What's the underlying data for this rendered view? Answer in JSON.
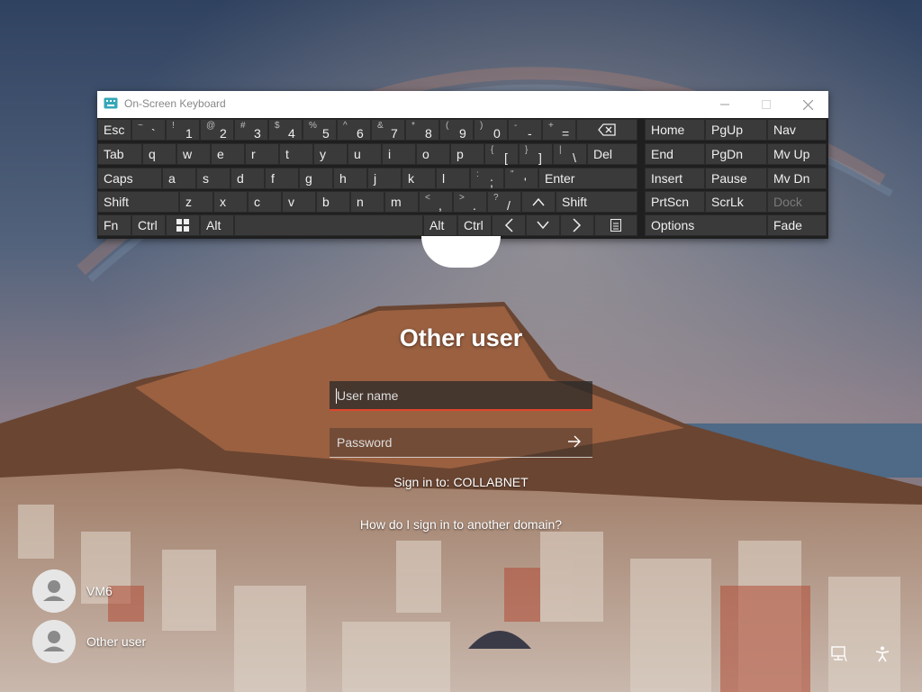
{
  "osk": {
    "title": "On-Screen Keyboard",
    "colors": {
      "titlebar": "#ffffff",
      "body": "#1f1f1f",
      "key": "#3a3a3a"
    },
    "rows": [
      [
        {
          "main": "Esc"
        },
        {
          "sec": "~",
          "pri": "`"
        },
        {
          "sec": "!",
          "pri": "1"
        },
        {
          "sec": "@",
          "pri": "2"
        },
        {
          "sec": "#",
          "pri": "3"
        },
        {
          "sec": "$",
          "pri": "4"
        },
        {
          "sec": "%",
          "pri": "5"
        },
        {
          "sec": "^",
          "pri": "6"
        },
        {
          "sec": "&",
          "pri": "7"
        },
        {
          "sec": "*",
          "pri": "8"
        },
        {
          "sec": "(",
          "pri": "9"
        },
        {
          "sec": ")",
          "pri": "0"
        },
        {
          "sec": "-",
          "pri": "-"
        },
        {
          "sec": "+",
          "pri": "="
        },
        {
          "icon": "backspace-icon"
        }
      ],
      [
        {
          "main": "Tab"
        },
        {
          "main": "q"
        },
        {
          "main": "w"
        },
        {
          "main": "e"
        },
        {
          "main": "r"
        },
        {
          "main": "t"
        },
        {
          "main": "y"
        },
        {
          "main": "u"
        },
        {
          "main": "i"
        },
        {
          "main": "o"
        },
        {
          "main": "p"
        },
        {
          "sec": "{",
          "pri": "["
        },
        {
          "sec": "}",
          "pri": "]"
        },
        {
          "sec": "|",
          "pri": "\\"
        },
        {
          "main": "Del"
        }
      ],
      [
        {
          "main": "Caps"
        },
        {
          "main": "a"
        },
        {
          "main": "s"
        },
        {
          "main": "d"
        },
        {
          "main": "f"
        },
        {
          "main": "g"
        },
        {
          "main": "h"
        },
        {
          "main": "j"
        },
        {
          "main": "k"
        },
        {
          "main": "l"
        },
        {
          "sec": ":",
          "pri": ";"
        },
        {
          "sec": "\"",
          "pri": "'"
        },
        {
          "main": "Enter"
        }
      ],
      [
        {
          "main": "Shift"
        },
        {
          "main": "z"
        },
        {
          "main": "x"
        },
        {
          "main": "c"
        },
        {
          "main": "v"
        },
        {
          "main": "b"
        },
        {
          "main": "n"
        },
        {
          "main": "m"
        },
        {
          "sec": "<",
          "pri": ","
        },
        {
          "sec": ">",
          "pri": "."
        },
        {
          "sec": "?",
          "pri": "/"
        },
        {
          "icon": "arrow-up-icon"
        },
        {
          "main": "Shift"
        }
      ],
      [
        {
          "main": "Fn"
        },
        {
          "main": "Ctrl"
        },
        {
          "icon": "windows-icon"
        },
        {
          "main": "Alt"
        },
        {
          "main": ""
        },
        {
          "main": "Alt"
        },
        {
          "main": "Ctrl"
        },
        {
          "icon": "arrow-left-icon"
        },
        {
          "icon": "arrow-down-icon"
        },
        {
          "icon": "arrow-right-icon"
        },
        {
          "icon": "menu-icon"
        }
      ]
    ],
    "nav_cols": [
      [
        "Home",
        "End",
        "Insert",
        "PrtScn",
        "Options"
      ],
      [
        "PgUp",
        "PgDn",
        "Pause",
        "ScrLk",
        ""
      ],
      [
        "Nav",
        "Mv Up",
        "Mv Dn",
        "Dock",
        "Fade"
      ]
    ]
  },
  "signin": {
    "title": "Other user",
    "username_placeholder": "User name",
    "password_placeholder": "Password",
    "domain_text": "Sign in to: COLLABNET",
    "domain_help": "How do I sign in to another domain?",
    "accent": "#e0442b"
  },
  "users": [
    "VM6",
    "Other user"
  ]
}
